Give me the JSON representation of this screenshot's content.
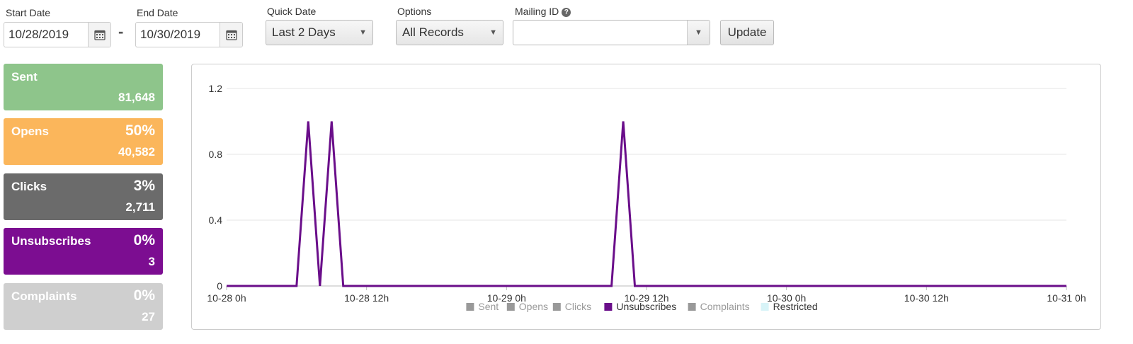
{
  "filters": {
    "start_date": {
      "label": "Start Date",
      "value": "10/28/2019",
      "icon": "calendar-icon"
    },
    "separator": "-",
    "end_date": {
      "label": "End Date",
      "value": "10/30/2019",
      "icon": "calendar-icon"
    },
    "quick_date": {
      "label": "Quick Date",
      "value": "Last 2 Days"
    },
    "options": {
      "label": "Options",
      "value": "All Records"
    },
    "mailing_id": {
      "label": "Mailing ID",
      "help_icon": "question-circle-icon",
      "value": ""
    },
    "update_label": "Update"
  },
  "cards": [
    {
      "key": "sent",
      "name": "Sent",
      "percent": "",
      "count": "81,648",
      "color": "#8ec58b"
    },
    {
      "key": "opens",
      "name": "Opens",
      "percent": "50%",
      "count": "40,582",
      "color": "#fbb65b"
    },
    {
      "key": "clicks",
      "name": "Clicks",
      "percent": "3%",
      "count": "2,711",
      "color": "#6b6b6b"
    },
    {
      "key": "unsubscribes",
      "name": "Unsubscribes",
      "percent": "0%",
      "count": "3",
      "color": "#7c0d91"
    },
    {
      "key": "complaints",
      "name": "Complaints",
      "percent": "0%",
      "count": "27",
      "color": "#cfcfcf"
    }
  ],
  "chart_data": {
    "type": "line",
    "ylim": [
      0,
      1.2
    ],
    "y_ticks": [
      "0",
      "0.4",
      "0.8",
      "1.2"
    ],
    "x_ticks": [
      "10-28 0h",
      "10-28 12h",
      "10-29 0h",
      "10-29 12h",
      "10-30 0h",
      "10-30 12h",
      "10-31 0h"
    ],
    "x_range_hours": [
      0,
      72
    ],
    "grid": true,
    "legend_position": "bottom",
    "legend": [
      {
        "name": "Sent",
        "color": "#999999"
      },
      {
        "name": "Opens",
        "color": "#999999"
      },
      {
        "name": "Clicks",
        "color": "#999999"
      },
      {
        "name": "Unsubscribes",
        "color": "#6a0e8a"
      },
      {
        "name": "Complaints",
        "color": "#999999"
      },
      {
        "name": "Restricted",
        "color": "#d8f4f8"
      }
    ],
    "series": [
      {
        "name": "Unsubscribes",
        "color": "#6a0e8a",
        "points": [
          [
            0,
            0
          ],
          [
            6,
            0
          ],
          [
            7,
            1
          ],
          [
            8,
            0
          ],
          [
            9,
            1
          ],
          [
            10,
            0
          ],
          [
            33,
            0
          ],
          [
            34,
            1
          ],
          [
            35,
            0
          ],
          [
            72,
            0
          ]
        ]
      }
    ]
  }
}
